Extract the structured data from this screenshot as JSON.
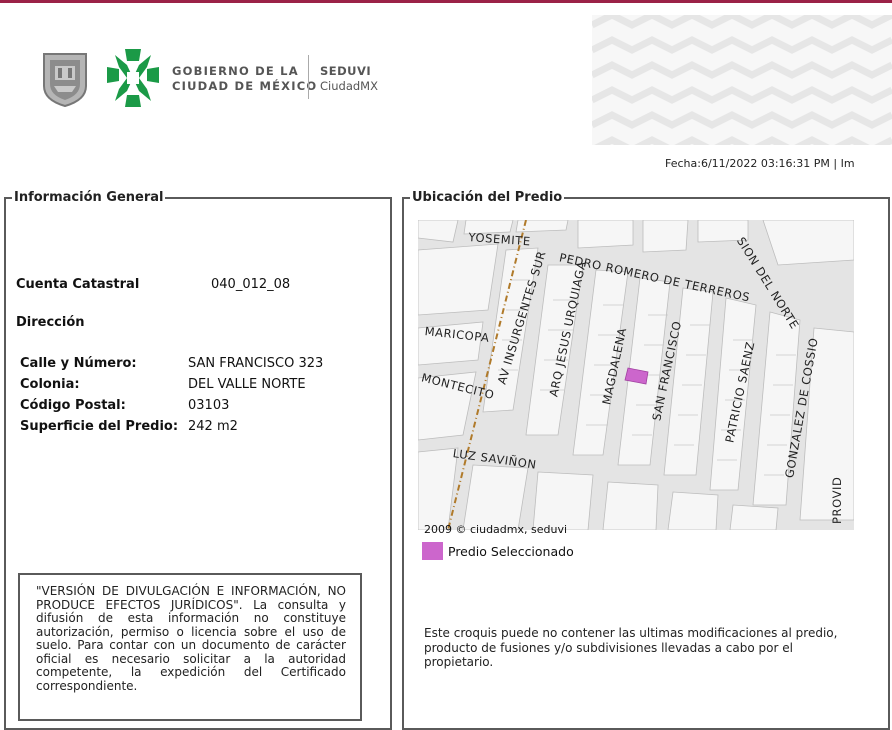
{
  "header": {
    "gov_line1": "GOBIERNO DE LA",
    "gov_line2": "CIUDAD DE MÉXICO",
    "agency": "SEDUVI",
    "agency_sub": "CiudadMX",
    "fecha": "Fecha:6/11/2022 03:16:31 PM | Im"
  },
  "info_general": {
    "title": "Información General",
    "cuenta_label": "Cuenta Catastral",
    "cuenta_value": "040_012_08",
    "direccion_label": "Dirección",
    "calle_label": "Calle y Número:",
    "calle_value": "SAN FRANCISCO 323",
    "colonia_label": "Colonia:",
    "colonia_value": "DEL VALLE NORTE",
    "cp_label": "Código Postal:",
    "cp_value": "03103",
    "superficie_label": "Superficie del Predio:",
    "superficie_value": "242 m2",
    "disclaimer": "\"VERSIÓN DE DIVULGACIÓN E INFORMACIÓN, NO PRODUCE EFECTOS JURÍDICOS\". La consulta y difusión de esta información no constituye autorización, permiso o licencia sobre el uso de suelo. Para contar con un documento de carácter oficial es necesario solicitar a la autoridad competente, la expedición del Certificado correspondiente."
  },
  "ubicacion": {
    "title": "Ubicación del Predio",
    "map_labels": {
      "yosemite": "YOSEMITE",
      "pedro_romero": "PEDRO ROMERO DE TERREROS",
      "sion_del_norte": "SION DEL NORTE",
      "maricopa": "MARICOPA",
      "insurgentes": "AV INSURGENTES SUR",
      "jesus_urquiaga": "ARQ JESUS URQUIAGA",
      "magdalena": "MAGDALENA",
      "san_francisco": "SAN FRANCISCO",
      "patricio_saenz": "PATRICIO SAENZ",
      "gonzalez_cossio": "GONZALEZ DE COSSIO",
      "montecito": "MONTECITO",
      "luz_savinon": "LUZ SAVIÑON",
      "provi": "PROVID"
    },
    "copyright": "2009 © ciudadmx, seduvi",
    "legend_label": "Predio Seleccionado",
    "legend_color": "#cc66cc",
    "croquis_note": "Este croquis puede no contener las ultimas modificaciones al predio, producto de fusiones y/o subdivisiones llevadas a cabo por el propietario."
  }
}
